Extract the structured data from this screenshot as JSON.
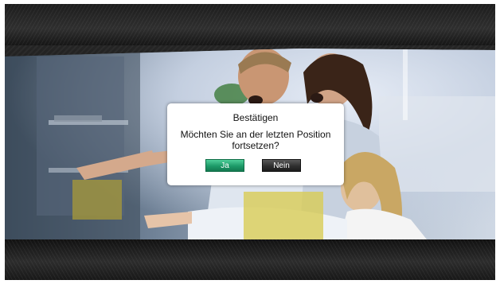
{
  "dialog": {
    "title": "Bestätigen",
    "message_line1": "Möchten Sie an der letzten Position",
    "message_line2": "fortsetzen?",
    "buttons": {
      "yes_label": "Ja",
      "no_label": "Nein",
      "focused": "yes"
    }
  },
  "colors": {
    "dialog_background": "#ffffff",
    "focused_button": "#1d9a68",
    "unfocused_button": "#2f2f2f",
    "frame": "#1e1e1e"
  }
}
